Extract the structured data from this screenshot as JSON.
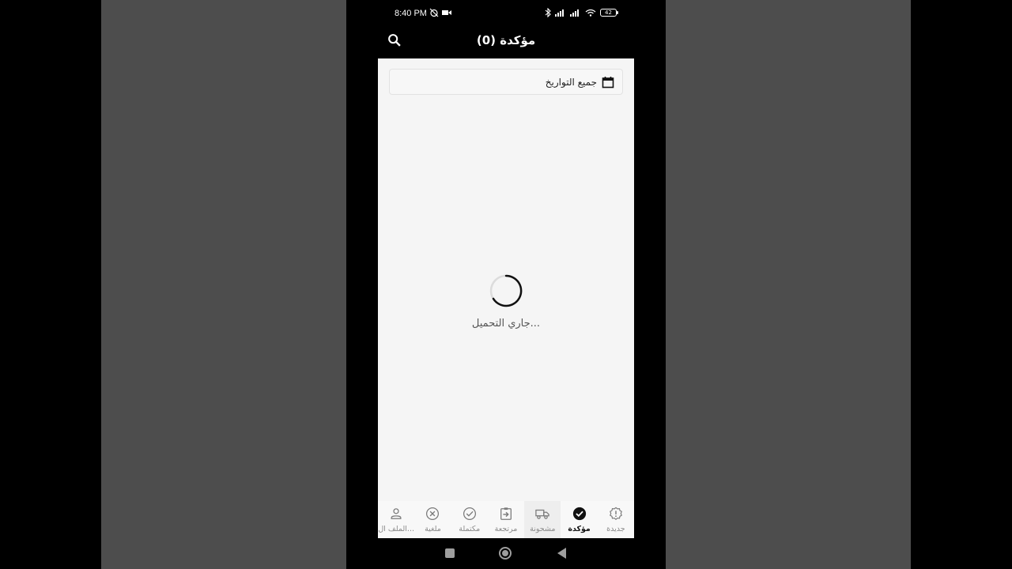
{
  "status_bar": {
    "time": "8:40 PM",
    "battery": "42"
  },
  "app_bar": {
    "title": "مؤكدة (0)"
  },
  "filter": {
    "date_label": "جميع التواريخ"
  },
  "loading": {
    "text": "جاري التحميل..."
  },
  "bottom_nav": {
    "active_index": 1,
    "items": [
      {
        "label": "جديدة",
        "icon": "alert-badge-icon"
      },
      {
        "label": "مؤكدة",
        "icon": "check-circle-filled-icon"
      },
      {
        "label": "مشحونة",
        "icon": "truck-icon"
      },
      {
        "label": "مرتجعة",
        "icon": "return-clipboard-icon"
      },
      {
        "label": "مكتملة",
        "icon": "check-circle-outline-icon"
      },
      {
        "label": "ملغية",
        "icon": "cancel-circle-icon"
      },
      {
        "label": "الملف ال...",
        "icon": "person-icon"
      }
    ]
  },
  "colors": {
    "background_side": "#4d4d4d",
    "content_bg": "#f5f5f5",
    "active": "#111111",
    "inactive": "#8a8a8a"
  }
}
